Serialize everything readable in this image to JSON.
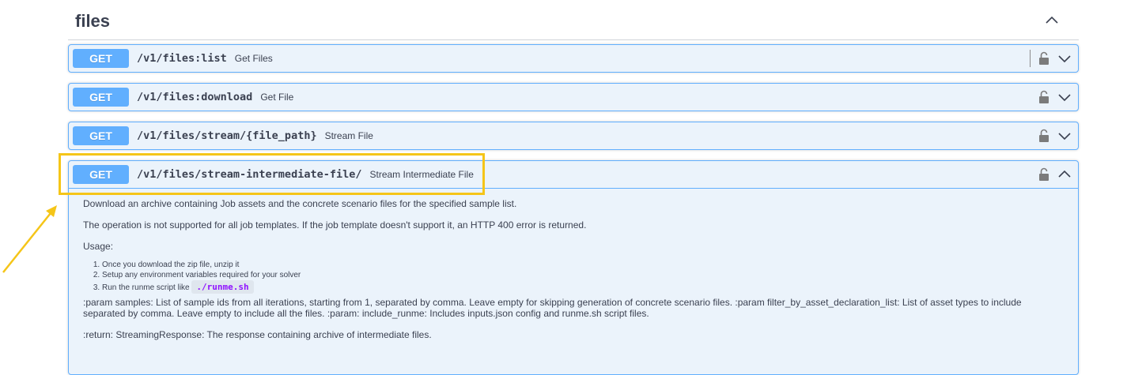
{
  "section": {
    "title": "files",
    "collapse_icon": "chevron-up-icon"
  },
  "operations": [
    {
      "method": "GET",
      "path": "/v1/files:list",
      "summary": "Get Files"
    },
    {
      "method": "GET",
      "path": "/v1/files:download",
      "summary": "Get File"
    },
    {
      "method": "GET",
      "path": "/v1/files/stream/{file_path}",
      "summary": "Stream File"
    },
    {
      "method": "GET",
      "path": "/v1/files/stream-intermediate-file/",
      "summary": "Stream Intermediate File"
    }
  ],
  "expanded": {
    "p1": "Download an archive containing Job assets and the concrete scenario files for the specified sample list.",
    "p2": "The operation is not supported for all job templates. If the job template doesn't support it, an HTTP 400 error is returned.",
    "usage_label": "Usage:",
    "steps": [
      "Once you download the zip file, unzip it",
      "Setup any environment variables required for your solver",
      "Run the runme script like"
    ],
    "code": "./runme.sh",
    "params": ":param samples: List of sample ids from all iterations, starting from 1, separated by comma. Leave empty for skipping generation of concrete scenario files. :param filter_by_asset_declaration_list: List of asset types to include separated by comma. Leave empty to include all the files. :param: include_runme: Includes inputs.json config and runme.sh script files.",
    "returns": ":return: StreamingResponse: The response containing archive of intermediate files."
  },
  "colors": {
    "get": "#61affe",
    "get_bg": "#ebf3fb",
    "highlight": "#f5c518",
    "code": "#9012fe"
  }
}
